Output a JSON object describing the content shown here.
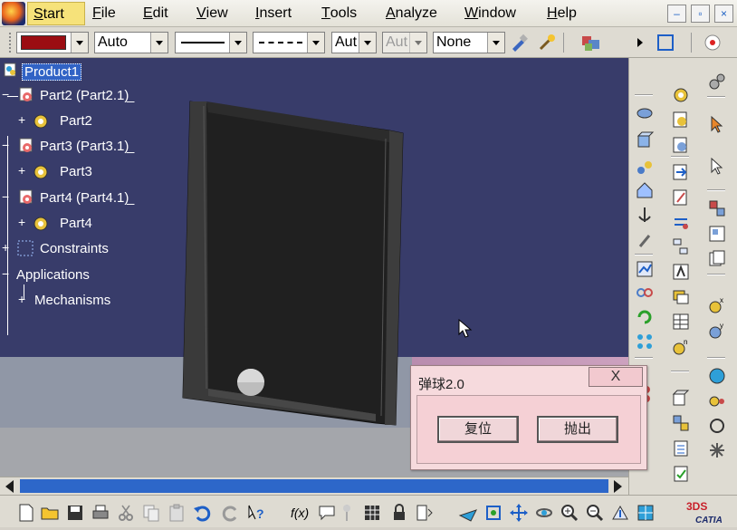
{
  "menubar": {
    "items": [
      "Start",
      "File",
      "Edit",
      "View",
      "Insert",
      "Tools",
      "Analyze",
      "Window",
      "Help"
    ],
    "underlines": [
      "S",
      "F",
      "E",
      "V",
      "I",
      "T",
      "A",
      "W",
      "H"
    ],
    "window_buttons": [
      "–",
      "▫",
      "×"
    ]
  },
  "toolbar": {
    "color_swatch": "#9b0d12",
    "line_weight_value": "Auto",
    "linetype_value": "Aut",
    "thickness_value": "Aut",
    "layer_value": "None"
  },
  "tree": {
    "root": "Product1",
    "nodes": [
      {
        "label": "Part2 (Part2.1)",
        "child": "Part2"
      },
      {
        "label": "Part3 (Part3.1)",
        "child": "Part3"
      },
      {
        "label": "Part4 (Part4.1)",
        "child": "Part4"
      }
    ],
    "constraints": "Constraints",
    "applications": "Applications",
    "mechanisms": "Mechanisms"
  },
  "dialog": {
    "title": "弹球2.0",
    "close": "X",
    "reset_button": "复位",
    "throw_button": "抛出"
  },
  "colors": {
    "viewport_bg": "#383c6a",
    "tree_text": "#ffffff",
    "selection": "#3163c5",
    "dialog_bg": "#f6dadd",
    "scroll_thumb": "#2d67c9"
  },
  "brand": {
    "logo_text": "CATIA",
    "logo_mark": "3DS"
  }
}
